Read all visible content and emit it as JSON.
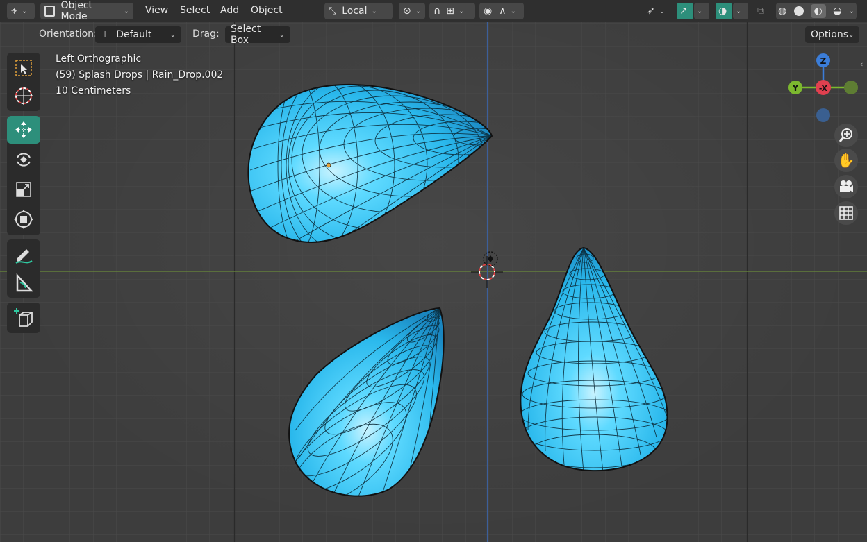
{
  "header": {
    "mode_label": "Object Mode",
    "menus": {
      "view": "View",
      "select": "Select",
      "add": "Add",
      "object": "Object"
    },
    "transform_orientation": "Local"
  },
  "tool_settings": {
    "orientation_label": "Orientation:",
    "orientation_value": "Default",
    "drag_label": "Drag:",
    "drag_value": "Select Box",
    "options_label": "Options"
  },
  "overlay": {
    "view_name": "Left Orthographic",
    "object_info": "(59) Splash Drops | Rain_Drop.002",
    "grid_scale": "10 Centimeters"
  },
  "gizmo": {
    "z": "Z",
    "y": "Y",
    "x": "-X"
  },
  "colors": {
    "accent": "#2d8f7b",
    "mesh": "#2fc8f5",
    "axis_z": "#3b7dd8",
    "axis_y": "#7cb82f",
    "axis_x": "#e0404f"
  },
  "left_tools": [
    "select-box",
    "cursor",
    "move",
    "rotate",
    "scale",
    "transform",
    "annotate",
    "measure",
    "add-cube"
  ],
  "active_tool": "move"
}
